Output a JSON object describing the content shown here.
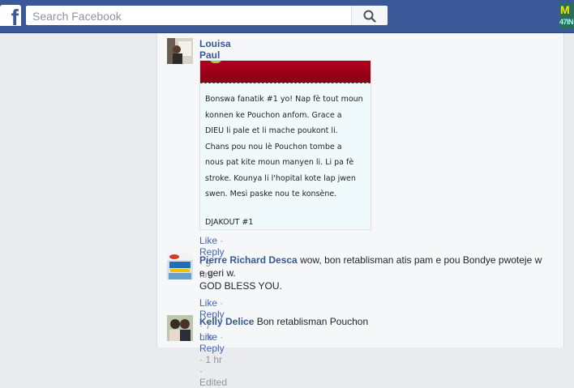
{
  "header": {
    "logo_letter": "f",
    "search_placeholder": "Search Facebook",
    "profile_badge_top": "M",
    "profile_badge_bottom": "47IN"
  },
  "comments": [
    {
      "author": "Louisa Paul",
      "attachment_lines": [
        "Bonswa fanatik #1 yo! Nap fè tout moun",
        "konnen ke Pouchon anfom. Grace a",
        "DIEU li pale et li mache poukont li.",
        "Chans pou nou lè Pouchon tombe a",
        "nous pat kite moun manyen li.  Li pa fè",
        "stroke. Kounya li l'hopital kote lap jwen",
        "swen. Mesi paske nou te konsène."
      ],
      "attachment_signature": "DJAKOUT #1",
      "like": "Like",
      "reply": "Reply",
      "sep": "·",
      "time": "9 hrs"
    },
    {
      "author": "Pierre Richard Desca",
      "text_line1": "wow, bon retablisman atis pam e pou Bondye pwoteje w",
      "text_line2": "e geri w.",
      "text_line3": "GOD BLESS YOU.",
      "like": "Like",
      "reply": "Reply",
      "sep": "·",
      "time": "7 hrs"
    },
    {
      "author": "Kelly Delice",
      "text_line1": "Bon retablisman Pouchon",
      "like": "Like",
      "reply": "Reply",
      "sep": "·",
      "time": "1 hr",
      "edited": "Edited"
    }
  ],
  "colors": {
    "topbar": "#3b5998",
    "link": "#365899",
    "meta": "#90949c"
  }
}
